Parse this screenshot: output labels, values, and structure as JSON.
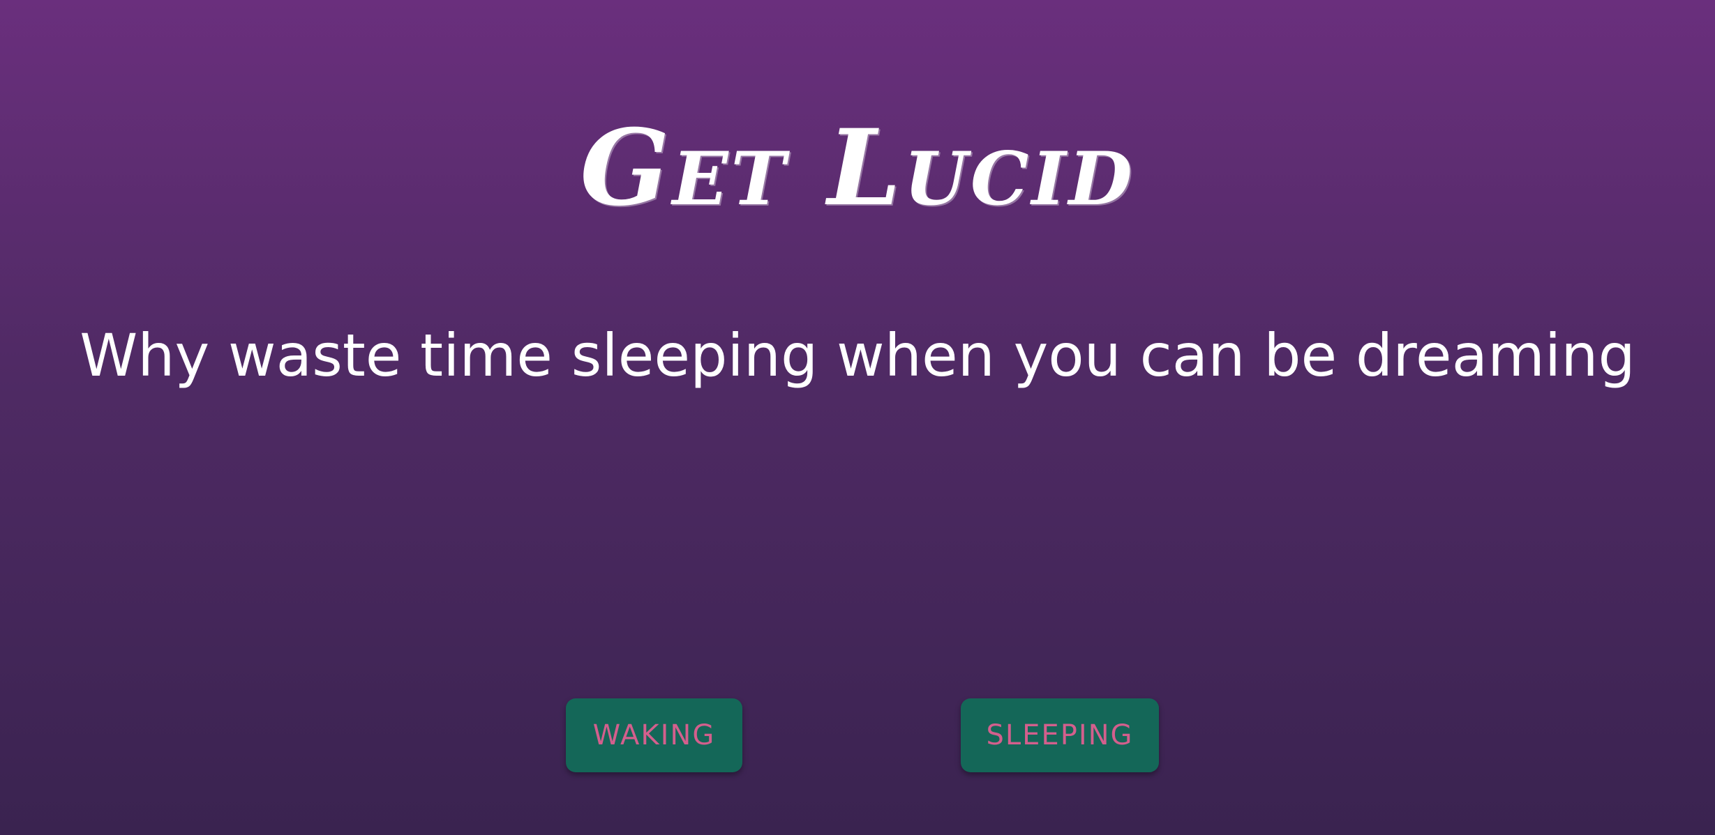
{
  "app": {
    "title": "Get Lucid",
    "tagline": "Why waste time sleeping when you can be dreaming"
  },
  "buttons": {
    "waking_label": "WAKING",
    "sleeping_label": "SLEEPING"
  },
  "colors": {
    "background_top": "#6a2f7d",
    "background_bottom": "#3a2350",
    "button_background": "#146758",
    "button_text": "#d35f8d",
    "title_text": "#ffffff"
  }
}
